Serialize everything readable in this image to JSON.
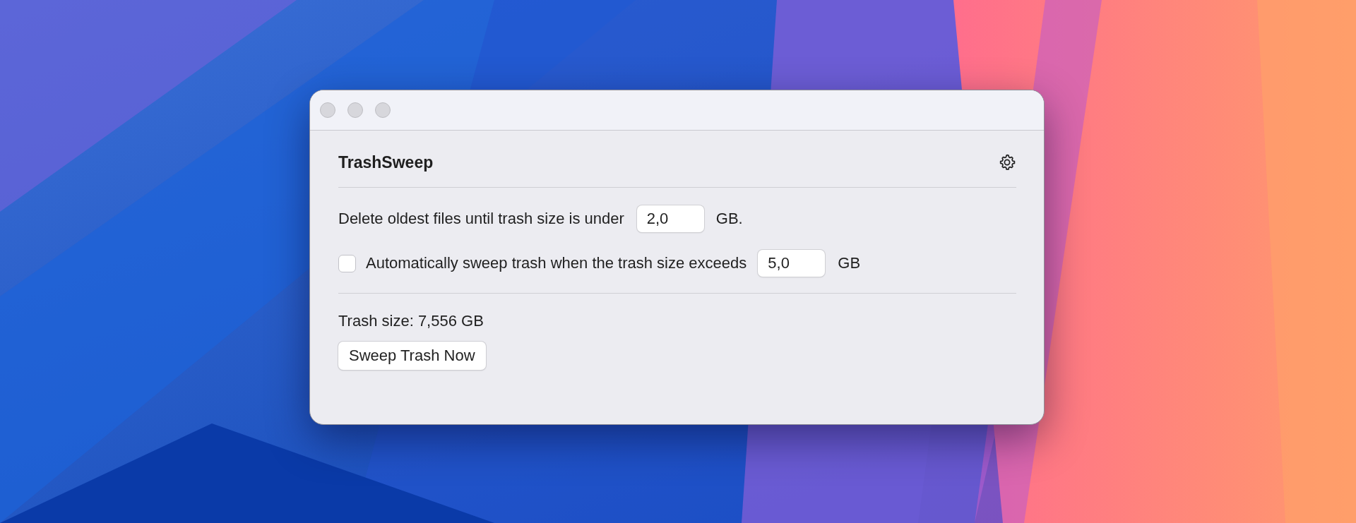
{
  "heading": "TrashSweep",
  "threshold_row": {
    "label": "Delete oldest files until trash size is under",
    "value": "2,0",
    "unit": "GB."
  },
  "auto_sweep": {
    "checked": false,
    "label": "Automatically sweep trash when the trash size exceeds",
    "value": "5,0",
    "unit": "GB"
  },
  "trash_size": "Trash size: 7,556 GB",
  "button": "Sweep Trash Now"
}
